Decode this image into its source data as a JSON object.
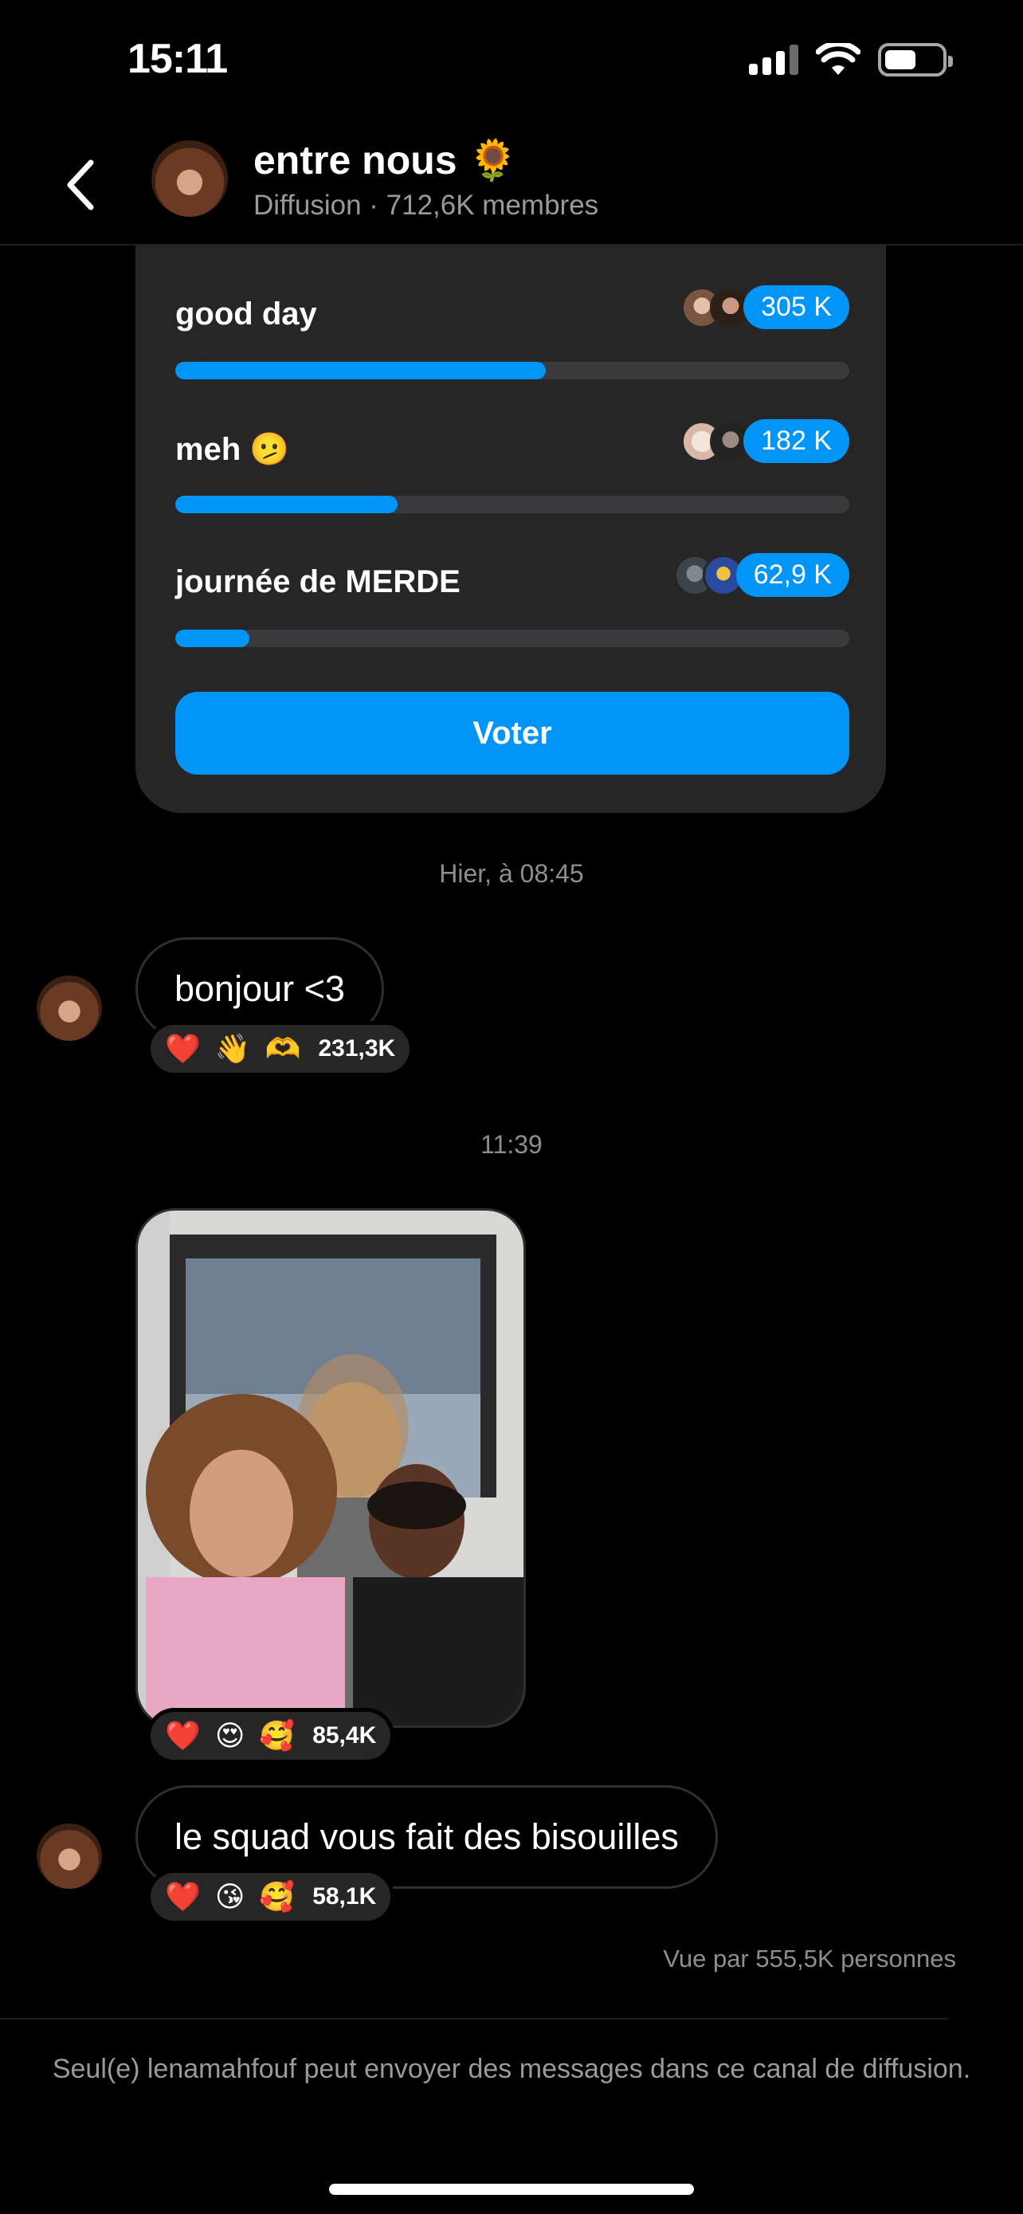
{
  "status_bar": {
    "time": "15:11"
  },
  "header": {
    "title": "entre nous 🌻",
    "subtitle": "Diffusion · 712,6K membres"
  },
  "poll": {
    "options": [
      {
        "label": "good day",
        "count": "305 K",
        "fraction": 0.55
      },
      {
        "label": "meh 🫤",
        "count": "182 K",
        "fraction": 0.33
      },
      {
        "label": "journée de MERDE",
        "count": "62,9 K",
        "fraction": 0.11
      }
    ],
    "vote_label": "Voter"
  },
  "messages": {
    "time1": "Hier, à 08:45",
    "msg1": {
      "text": "bonjour <3",
      "reactions": [
        "❤️",
        "👋",
        "🫶"
      ],
      "reaction_count": "231,3K"
    },
    "time2": "11:39",
    "photo": {
      "reactions": [
        "❤️",
        "😍",
        "🥰"
      ],
      "reaction_count": "85,4K"
    },
    "msg2": {
      "text": "le squad vous fait des bisouilles",
      "reactions": [
        "❤️",
        "😘",
        "🥰"
      ],
      "reaction_count": "58,1K"
    }
  },
  "seen_by": "Vue par 555,5K personnes",
  "footer_note": "Seul(e) lenamahfouf peut envoyer des messages dans ce canal de diffusion.",
  "colors": {
    "accent": "#0095f6",
    "card": "#262627",
    "background": "#000000"
  }
}
